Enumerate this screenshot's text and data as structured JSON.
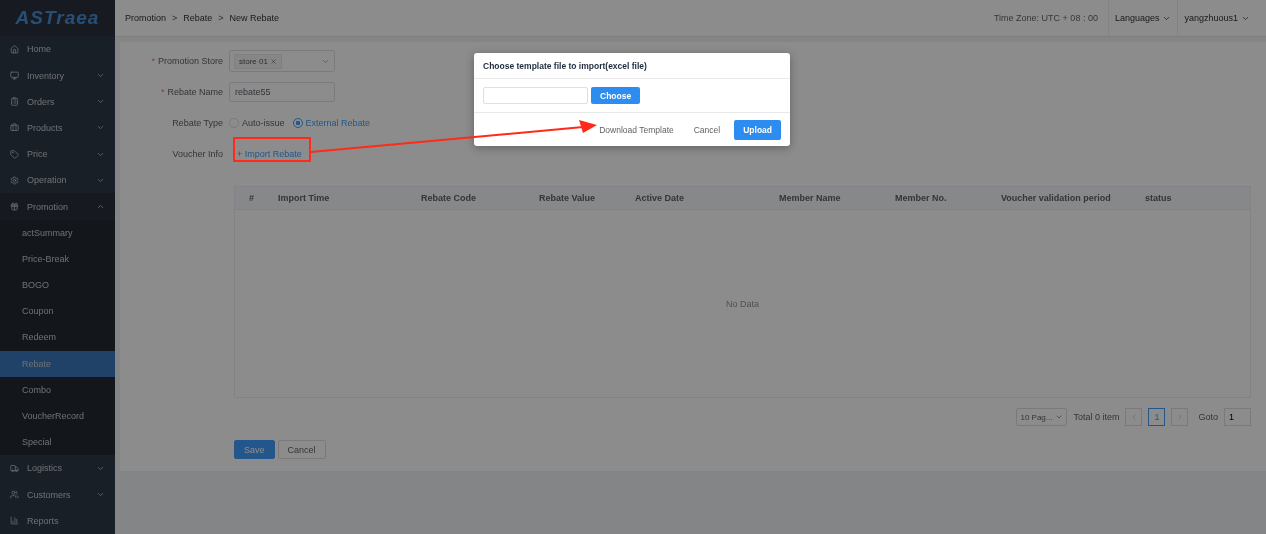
{
  "logo": {
    "text": "ASTraea"
  },
  "header": {
    "breadcrumb": [
      "Promotion",
      "Rebate",
      "New Rebate"
    ],
    "separator": ">",
    "timezone": "Time Zone: UTC + 08 : 00",
    "languages": "Languages",
    "user": "yangzhuous1"
  },
  "sidebar": {
    "items": [
      {
        "label": "Home",
        "expandable": false
      },
      {
        "label": "Inventory",
        "expandable": true,
        "expanded": false
      },
      {
        "label": "Orders",
        "expandable": true,
        "expanded": false
      },
      {
        "label": "Products",
        "expandable": true,
        "expanded": false
      },
      {
        "label": "Price",
        "expandable": true,
        "expanded": false
      },
      {
        "label": "Operation",
        "expandable": true,
        "expanded": false
      },
      {
        "label": "Promotion",
        "expandable": true,
        "expanded": true,
        "children": [
          {
            "label": "actSummary",
            "selected": false
          },
          {
            "label": "Price-Break",
            "selected": false
          },
          {
            "label": "BOGO",
            "selected": false
          },
          {
            "label": "Coupon",
            "selected": false
          },
          {
            "label": "Redeem",
            "selected": false
          },
          {
            "label": "Rebate",
            "selected": true
          },
          {
            "label": "Combo",
            "selected": false
          },
          {
            "label": "VoucherRecord",
            "selected": false
          },
          {
            "label": "Special",
            "selected": false
          }
        ]
      },
      {
        "label": "Logistics",
        "expandable": true,
        "expanded": false
      },
      {
        "label": "Customers",
        "expandable": true,
        "expanded": false
      },
      {
        "label": "Reports",
        "expandable": false
      }
    ]
  },
  "form": {
    "required_mark": "*",
    "fields": [
      {
        "kind": "select",
        "label": "Promotion Store",
        "required": true,
        "tags": [
          "store 01"
        ]
      },
      {
        "kind": "input",
        "label": "Rebate Name",
        "required": true,
        "value": "rebate55"
      },
      {
        "kind": "radio",
        "label": "Rebate Type",
        "required": false,
        "options": [
          {
            "label": "Auto-issue",
            "selected": false
          },
          {
            "label": "External Rebate",
            "selected": true
          }
        ]
      },
      {
        "kind": "link",
        "label": "Voucher Info",
        "required": false,
        "link": "+ Import Rebate"
      }
    ]
  },
  "table": {
    "columns": [
      "#",
      "Import Time",
      "Rebate Code",
      "Rebate Value",
      "Active Date",
      "Member Name",
      "Member No.",
      "Voucher validation period",
      "status"
    ],
    "empty": "No Data"
  },
  "pagination": {
    "page_size": "10 Pag...",
    "total": "Total 0 item",
    "pages": [
      {
        "label": "1",
        "selected": true
      }
    ],
    "goto_label": "Goto",
    "goto_value": "1"
  },
  "actions": {
    "save": "Save",
    "cancel": "Cancel"
  },
  "modal": {
    "title": "Choose template file to import(excel file)",
    "choose": "Choose",
    "download": "Download Template",
    "cancel": "Cancel",
    "upload": "Upload"
  }
}
